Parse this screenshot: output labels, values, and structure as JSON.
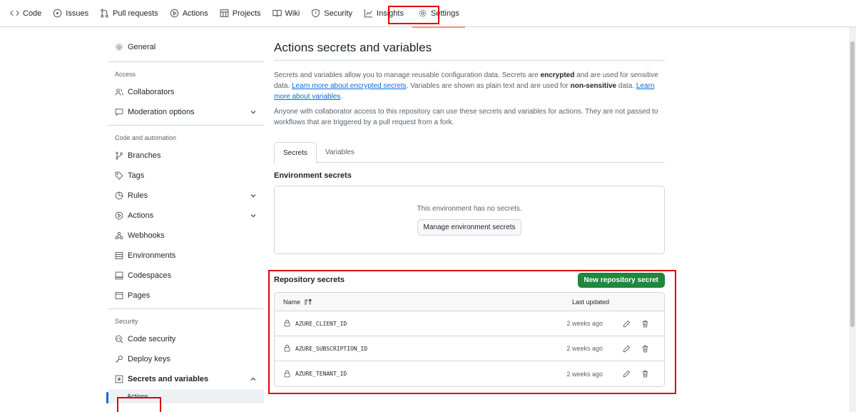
{
  "topnav": {
    "tabs": [
      {
        "label": "Code",
        "icon": "code-icon"
      },
      {
        "label": "Issues",
        "icon": "issue-icon"
      },
      {
        "label": "Pull requests",
        "icon": "pull-request-icon"
      },
      {
        "label": "Actions",
        "icon": "play-icon"
      },
      {
        "label": "Projects",
        "icon": "table-icon"
      },
      {
        "label": "Wiki",
        "icon": "book-icon"
      },
      {
        "label": "Security",
        "icon": "shield-icon"
      },
      {
        "label": "Insights",
        "icon": "graph-icon"
      },
      {
        "label": "Settings",
        "icon": "gear-icon"
      }
    ],
    "active": "Settings"
  },
  "sidebar": {
    "general": "General",
    "access_group": "Access",
    "collaborators": "Collaborators",
    "moderation": "Moderation options",
    "code_group": "Code and automation",
    "branches": "Branches",
    "tags": "Tags",
    "rules": "Rules",
    "actions": "Actions",
    "webhooks": "Webhooks",
    "environments": "Environments",
    "codespaces": "Codespaces",
    "pages": "Pages",
    "security_group": "Security",
    "code_security": "Code security",
    "deploy_keys": "Deploy keys",
    "secrets_variables": "Secrets and variables",
    "sub_actions": "Actions"
  },
  "main": {
    "title": "Actions secrets and variables",
    "desc_p1_a": "Secrets and variables allow you to manage reusable configuration data. Secrets are ",
    "desc_p1_b": "encrypted",
    "desc_p1_c": " and are used for sensitive data. ",
    "desc_link1": "Learn more about encrypted secrets",
    "desc_p1_d": ". Variables are shown as plain text and are used for ",
    "desc_p1_e": "non-sensitive",
    "desc_p1_f": " data. ",
    "desc_link2": "Learn more about variables",
    "desc_p1_g": ".",
    "desc_p2": "Anyone with collaborator access to this repository can use these secrets and variables for actions. They are not passed to workflows that are triggered by a pull request from a fork.",
    "tabs": {
      "secrets": "Secrets",
      "variables": "Variables"
    },
    "env_heading": "Environment secrets",
    "env_empty": "This environment has no secrets.",
    "env_button": "Manage environment secrets",
    "repo_heading": "Repository secrets",
    "new_secret_button": "New repository secret",
    "table": {
      "col_name": "Name",
      "col_updated": "Last updated",
      "rows": [
        {
          "name": "AZURE_CLIENT_ID",
          "updated": "2 weeks ago"
        },
        {
          "name": "AZURE_SUBSCRIPTION_ID",
          "updated": "2 weeks ago"
        },
        {
          "name": "AZURE_TENANT_ID",
          "updated": "2 weeks ago"
        }
      ]
    }
  },
  "colors": {
    "accent": "#0969da",
    "primary_button": "#1f883d",
    "highlight_box": "#e00000",
    "active_tab_underline": "#fd8c73"
  }
}
